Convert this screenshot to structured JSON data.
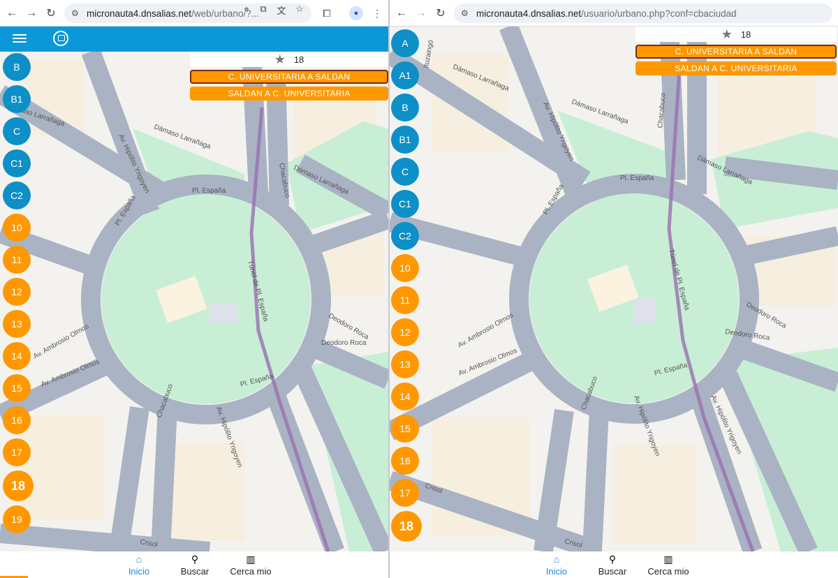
{
  "left": {
    "url_host": "micronauta4.dnsalias.net",
    "url_path": "/web/urbano/?...",
    "routes": [
      "B",
      "B1",
      "C",
      "C1",
      "C2",
      "10",
      "11",
      "12",
      "13",
      "14",
      "15",
      "16",
      "17",
      "18",
      "19"
    ],
    "selected_route": "18",
    "favorite_number": "18",
    "directions": [
      "C. UNIVERSITARIA A SALDAN",
      "SALDAN A C. UNIVERSITARIA"
    ],
    "tabs": [
      "Inicio",
      "Buscar",
      "Cerca mio"
    ]
  },
  "right": {
    "url_host": "micronauta4.dnsalias.net",
    "url_path": "/usuario/urbano.php?conf=cbaciudad",
    "routes": [
      "A",
      "A1",
      "B",
      "B1",
      "C",
      "C1",
      "C2",
      "10",
      "11",
      "12",
      "13",
      "14",
      "15",
      "16",
      "17",
      "18"
    ],
    "selected_route": "18",
    "favorite_number": "18",
    "directions": [
      "C. UNIVERSITARIA A SALDAN",
      "SALDAN A C. UNIVERSITARIA"
    ],
    "tabs": [
      "Inicio",
      "Buscar",
      "Cerca mio"
    ]
  },
  "map_labels": {
    "street_1": "Dámaso Larrañaga",
    "street_2": "Av. Hipólito Yrigoyen",
    "street_3": "Pl. España",
    "street_4": "Chacabuco",
    "street_5": "Túnel de Pl. España",
    "street_6": "Deodoro Roca",
    "street_7": "Av. Ambrosio Olmos",
    "street_8": "Crisol",
    "street_9": "Ituzaingó"
  },
  "colors": {
    "brand_blue": "#0b98d8",
    "route_blue": "#0d8fc8",
    "route_orange": "#ff9800",
    "active_tab": "#1e88e5",
    "park": "#c8efd6",
    "road": "#a9b3c4",
    "route_line": "#9a6fb0"
  },
  "icons": [
    "back-arrow-icon",
    "forward-arrow-icon",
    "reload-icon",
    "site-settings-icon",
    "location-icon",
    "install-app-icon",
    "translate-icon",
    "bookmark-star-icon",
    "extensions-icon",
    "profile-icon",
    "more-menu-icon",
    "hamburger-icon",
    "app-logo-icon",
    "favorite-star-icon",
    "home-icon",
    "search-icon",
    "map-icon"
  ]
}
